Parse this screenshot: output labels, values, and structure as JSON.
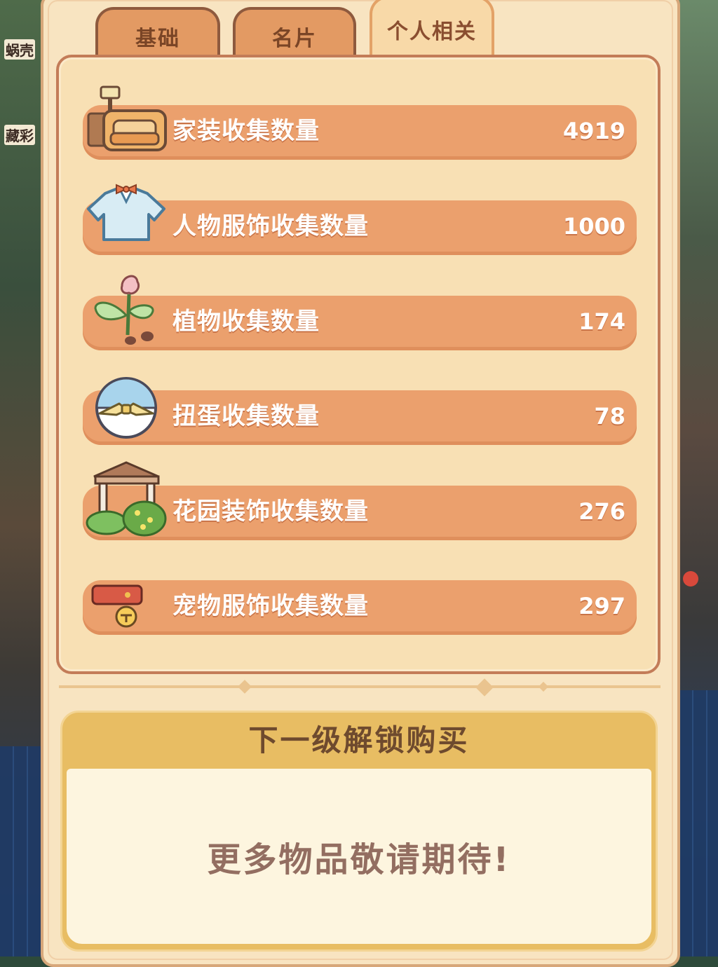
{
  "background": {
    "left_labels": [
      "蜗壳",
      "藏彩"
    ]
  },
  "tabs": [
    {
      "label": "基础",
      "active": false
    },
    {
      "label": "名片",
      "active": false
    },
    {
      "label": "个人相关",
      "active": true
    }
  ],
  "stats": [
    {
      "icon": "furniture-icon",
      "label": "家装收集数量",
      "value": "4919"
    },
    {
      "icon": "clothing-icon",
      "label": "人物服饰收集数量",
      "value": "1000"
    },
    {
      "icon": "plant-icon",
      "label": "植物收集数量",
      "value": "174"
    },
    {
      "icon": "gacha-egg-icon",
      "label": "扭蛋收集数量",
      "value": "78"
    },
    {
      "icon": "garden-decor-icon",
      "label": "花园装饰收集数量",
      "value": "276"
    },
    {
      "icon": "pet-collar-icon",
      "label": "宠物服饰收集数量",
      "value": "297"
    }
  ],
  "unlock": {
    "title": "下一级解锁购买",
    "message": "更多物品敬请期待!"
  },
  "colors": {
    "panel_bg": "#f8e4c1",
    "row_bg": "#eba06d",
    "tab_bg": "#e39a63",
    "active_tab_bg": "#f8d9a8",
    "unlock_header": "#e8bd63"
  }
}
